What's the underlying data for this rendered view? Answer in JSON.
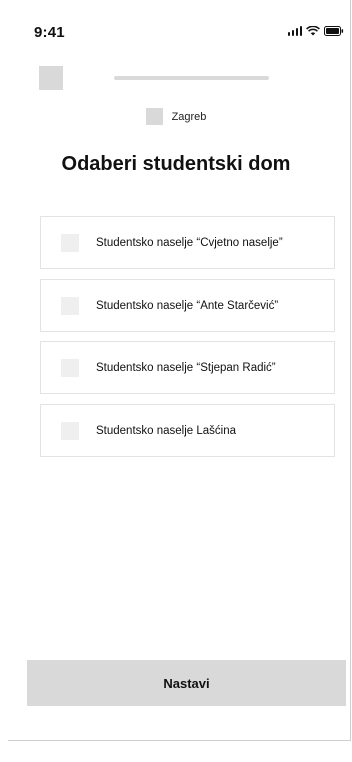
{
  "status_bar": {
    "time": "9:41",
    "icons": [
      "signal-icon",
      "wifi-icon",
      "battery-icon"
    ]
  },
  "header": {
    "back_icon": "back-placeholder-icon",
    "progress": 0.0
  },
  "city": {
    "label": "Zagreb",
    "icon": "city-placeholder-icon"
  },
  "title": "Odaberi studentski dom",
  "options": [
    {
      "label": "Studentsko naselje “Cvjetno naselje”",
      "selected": false
    },
    {
      "label": "Studentsko naselje “Ante Starčević”",
      "selected": false
    },
    {
      "label": "Studentsko naselje “Stjepan Radić”",
      "selected": false
    },
    {
      "label": "Studentsko naselje Lašćina",
      "selected": false
    }
  ],
  "continue_label": "Nastavi",
  "colors": {
    "placeholder": "#d9d9d9",
    "checkbox": "#efefef",
    "border": "#e3e3e3",
    "text": "#111111"
  }
}
